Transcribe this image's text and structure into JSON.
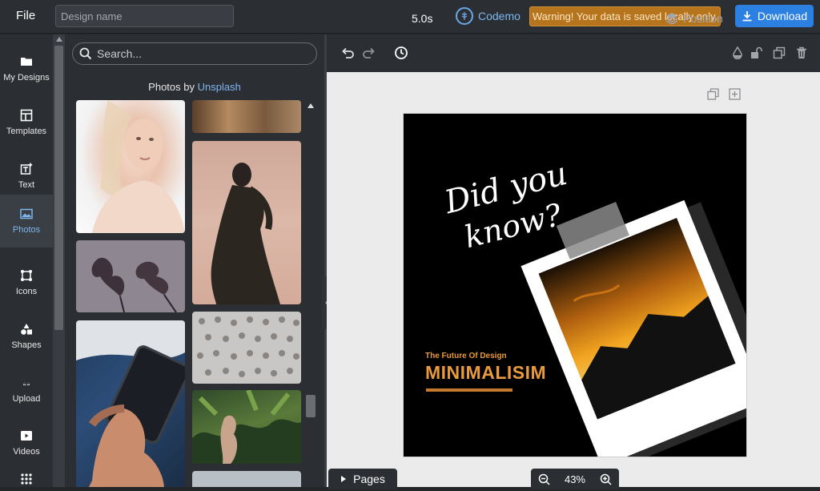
{
  "topbar": {
    "file_label": "File",
    "design_name_placeholder": "Design name",
    "design_name_value": "",
    "brand_name": "Codemo",
    "warning_text": "Warning! Your data is saved locally only.",
    "download_label": "Download"
  },
  "leftnav": {
    "items": [
      {
        "label": "My Designs",
        "icon": "folder-icon"
      },
      {
        "label": "Templates",
        "icon": "templates-icon"
      },
      {
        "label": "Text",
        "icon": "text-icon"
      },
      {
        "label": "Photos",
        "icon": "photo-icon"
      },
      {
        "label": "Icons",
        "icon": "icons-icon"
      },
      {
        "label": "Shapes",
        "icon": "shapes-icon"
      },
      {
        "label": "Upload",
        "icon": "upload-icon"
      },
      {
        "label": "Videos",
        "icon": "video-icon"
      }
    ],
    "active": "Photos"
  },
  "panel": {
    "search_placeholder": "Search...",
    "title_prefix": "Photos by ",
    "title_link": "Unsplash"
  },
  "toolbar": {
    "duration": "5.0s",
    "position_label": "Position"
  },
  "canvas": {
    "headline_line1": "Did you",
    "headline_line2": "know?",
    "subtitle": "The Future Of Design",
    "title": "MINIMALISIM",
    "accent_color": "#e89a3c"
  },
  "bottom": {
    "pages_label": "Pages",
    "zoom_level": "43%"
  },
  "colors": {
    "accent_blue": "#2b80e2",
    "warning_bg": "#b6741d",
    "dark_panel": "#2b2e33"
  }
}
